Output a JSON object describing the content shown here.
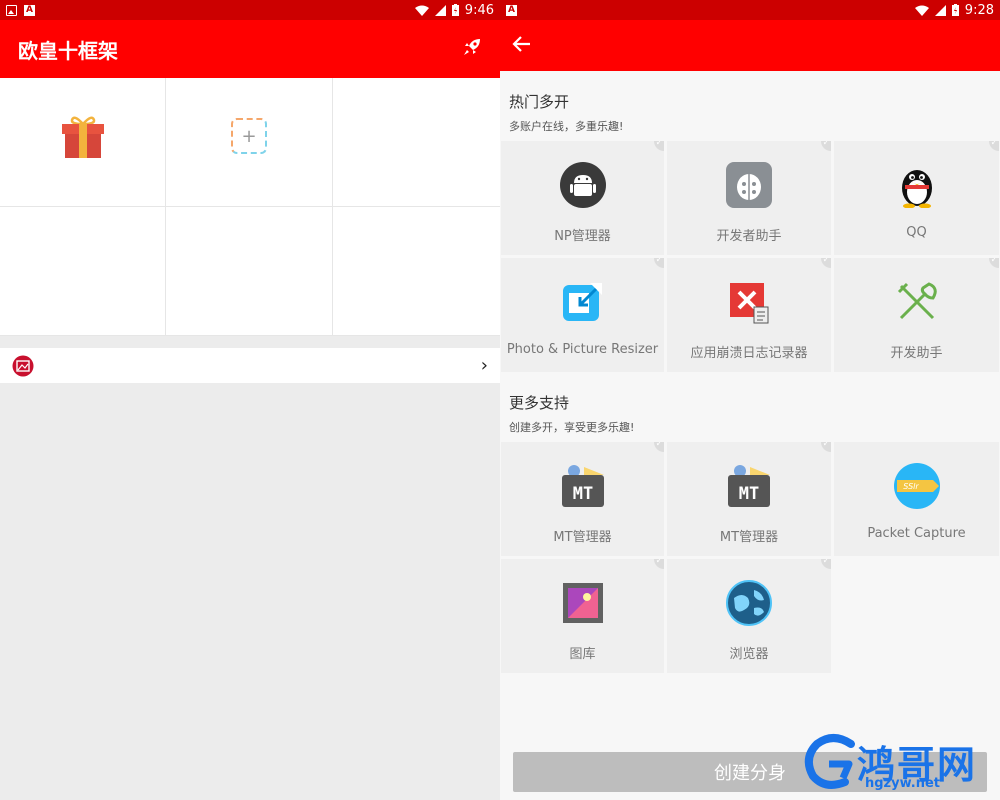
{
  "left_screen": {
    "status_bar": {
      "time": "9:46",
      "icons": [
        "image-icon",
        "a-icon",
        "wifi-icon",
        "signal-icon",
        "battery-icon"
      ]
    },
    "header": {
      "title": "欧皇十框架",
      "action_icon": "rocket-icon"
    },
    "grid": {
      "items": [
        "gift-icon",
        "add-icon"
      ]
    },
    "banner": {
      "icon": "gallery-badge-icon",
      "chevron": "›"
    }
  },
  "right_screen": {
    "status_bar": {
      "time": "9:28",
      "icons": [
        "a-icon",
        "wifi-icon",
        "signal-icon",
        "battery-icon"
      ]
    },
    "header": {
      "back_icon": "back-arrow-icon"
    },
    "hot_section": {
      "title": "热门多开",
      "subtitle": "多账户在线，多重乐趣!",
      "apps": [
        {
          "label": "NP管理器",
          "icon": "android-icon"
        },
        {
          "label": "开发者助手",
          "icon": "ladybug-icon"
        },
        {
          "label": "QQ",
          "icon": "qq-penguin-icon"
        },
        {
          "label": "Photo & Picture Resizer",
          "icon": "resize-icon"
        },
        {
          "label": "应用崩溃日志记录器",
          "icon": "crash-log-icon"
        },
        {
          "label": "开发助手",
          "icon": "tools-icon"
        }
      ]
    },
    "more_section": {
      "title": "更多支持",
      "subtitle": "创建多开，享受更多乐趣!",
      "apps": [
        {
          "label": "MT管理器",
          "icon": "mt-icon"
        },
        {
          "label": "MT管理器",
          "icon": "mt-icon"
        },
        {
          "label": "Packet Capture",
          "icon": "ssl-icon"
        },
        {
          "label": "图库",
          "icon": "gallery-icon"
        },
        {
          "label": "浏览器",
          "icon": "globe-icon"
        }
      ]
    },
    "create_button": "创建分身"
  },
  "watermark": {
    "text": "鸿哥网",
    "url": "hgzyw.net"
  },
  "colors": {
    "status_bar": "#cc0000",
    "app_bar": "#ff0000",
    "button": "#bdbdbd",
    "watermark": "#1a73e8"
  }
}
